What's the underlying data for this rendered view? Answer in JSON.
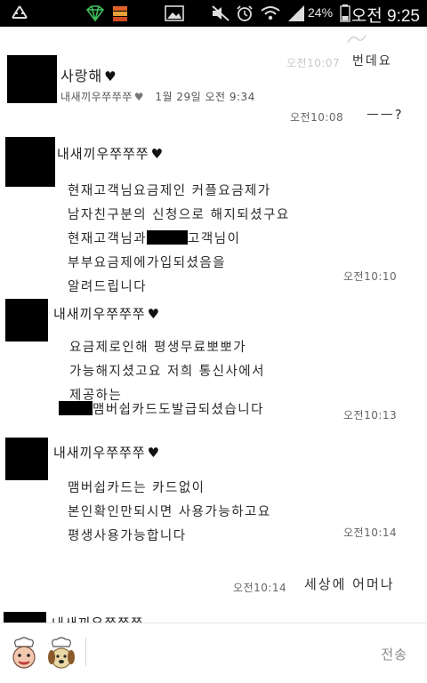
{
  "status_bar": {
    "battery_percent": "24%",
    "time": "오전 9:25",
    "icons": [
      "recycle-icon",
      "gem-icon",
      "stack-icon",
      "image-icon",
      "mute-icon",
      "alarm-icon",
      "wifi-icon",
      "signal-icon",
      "battery-icon"
    ]
  },
  "chat": {
    "top_partial": {
      "time": "오전10:07",
      "text": "번데요"
    },
    "profile": {
      "name": "사랑해",
      "sub": "내새끼우쭈쭈쭈",
      "date": "1월 29일 오전 9:34"
    },
    "my_message_1": {
      "time": "오전10:08",
      "text": "ㅡㅡ?"
    },
    "messages": [
      {
        "sender": "내새끼우쭈쭈쭈",
        "lines": [
          "현재고객님요금제인 커플요금제가",
          "남자친구분의 신청으로 해지되셨구요",
          "현재고객님과",
          "부부요금제에가입되셨음을",
          "알려드립니다"
        ],
        "line3_suffix": "고객님이",
        "time": "오전10:10"
      },
      {
        "sender": "내새끼우쭈쭈쭈",
        "lines": [
          "요금제로인해 평생무료뽀뽀가",
          "가능해지셨고요 저희 통신사에서",
          "제공하는",
          "맴버쉽카드도발급되셨습니다"
        ],
        "time": "오전10:13"
      },
      {
        "sender": "내새끼우쭈쭈쭈",
        "lines": [
          "맴버쉽카드는 카드없이",
          "본인확인만되시면 사용가능하고요",
          "평생사용가능합니다"
        ],
        "time": "오전10:14"
      }
    ],
    "my_message_2": {
      "time": "오전10:14",
      "text": "세상에 어머나"
    },
    "bottom_partial_sender": "내새끼우쭈쭈쭈"
  },
  "input_bar": {
    "send_label": "전송",
    "stickers": [
      "chef-face-icon",
      "chef-dog-icon"
    ]
  }
}
